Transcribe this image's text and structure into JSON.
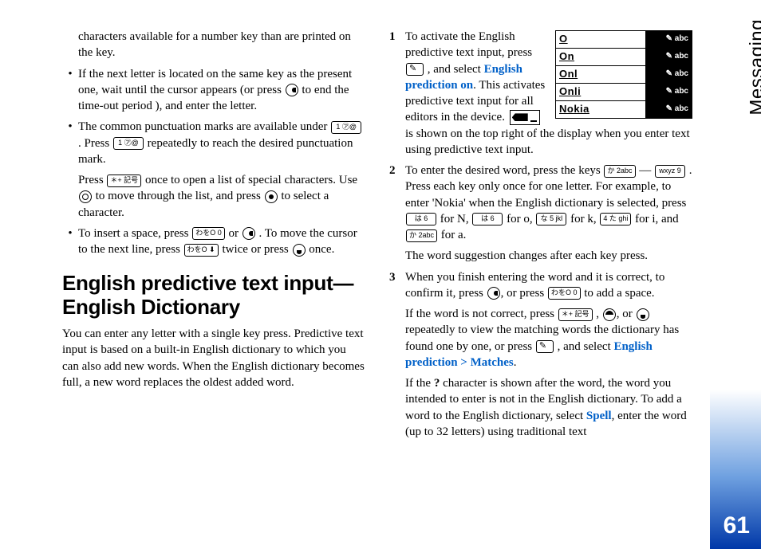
{
  "side_tab": "Messaging",
  "page_number": "61",
  "col1": {
    "frag0": "characters available for a number key than are printed on the key.",
    "b1a": "If the next letter is located on the same key as the present one, wait until the cursor appears (or press ",
    "b1b": " to end the time-out period ), and enter the letter.",
    "b2a": "The common punctuation marks are available under ",
    "b2b": " . Press ",
    "b2c": " repeatedly to reach the desired punctuation mark.",
    "b2d": "Press ",
    "b2e": " once to open a list of special characters. Use ",
    "b2f": " to move through the list, and press ",
    "b2g": " to select a character.",
    "b3a": "To insert a space, press ",
    "b3b": " or ",
    "b3c": ". To move the cursor to the next line, press ",
    "b3d": " twice or press ",
    "b3e": " once.",
    "h2": "English predictive text input—English Dictionary",
    "intro": "You can enter any letter with a single key press. Predictive text input is based on a built-in English dictionary to which you can also add new words. When the English dictionary becomes full, a new word replaces the oldest added word.",
    "key_1": "1 ㋐@",
    "key_star": "＊+ 記号",
    "key_0": "わをO 0",
    "key_0d": "わをO ⬇"
  },
  "col2": {
    "n1a": "To activate the English predictive text input, press ",
    "n1b": " , and select ",
    "n1hl": "English prediction on",
    "n1c": ". This activates predictive text input for all editors in the device. ",
    "n1d": " is shown on the top right of the display when you enter text using predictive text input.",
    "n2a": "To enter the desired word, press the keys ",
    "n2b": " — ",
    "n2c": " . Press each key only once for one letter. For example, to enter 'Nokia' when the English dictionary is selected, press ",
    "n2d": " for N, ",
    "n2e": " for o, ",
    "n2f": " for k, ",
    "n2g": " for i, and ",
    "n2h": " for a.",
    "n2i": "The word suggestion changes after each key press.",
    "n3a": "When you finish entering the word and it is correct, to confirm it, press ",
    "n3b": ", or press ",
    "n3c": " to add a space.",
    "n3d": "If the word is not correct, press ",
    "n3e": " , ",
    "n3f": ", or ",
    "n3g": " repeatedly to view the matching words the dictionary has found one by one, or press ",
    "n3h": " , and select ",
    "n3hl": "English prediction > Matches",
    "n3i": ".",
    "n3j1": "If the ",
    "n3q": "?",
    "n3j2": " character is shown after the word, the word you intended to enter is not in the English dictionary. To add a word to the English dictionary, select ",
    "n3hl2": "Spell",
    "n3j3": ", enter the word (up to 32 letters) using traditional text",
    "key_2": "か 2abc",
    "key_9": "wxyz 9",
    "key_6": "は 6",
    "key_5": "な 5 jkl",
    "key_4": "4 た ghi",
    "phone_tag": "abc",
    "p0": "O",
    "p1": "On",
    "p2": "Onl",
    "p3": "Onli",
    "p4": "Nokia"
  }
}
